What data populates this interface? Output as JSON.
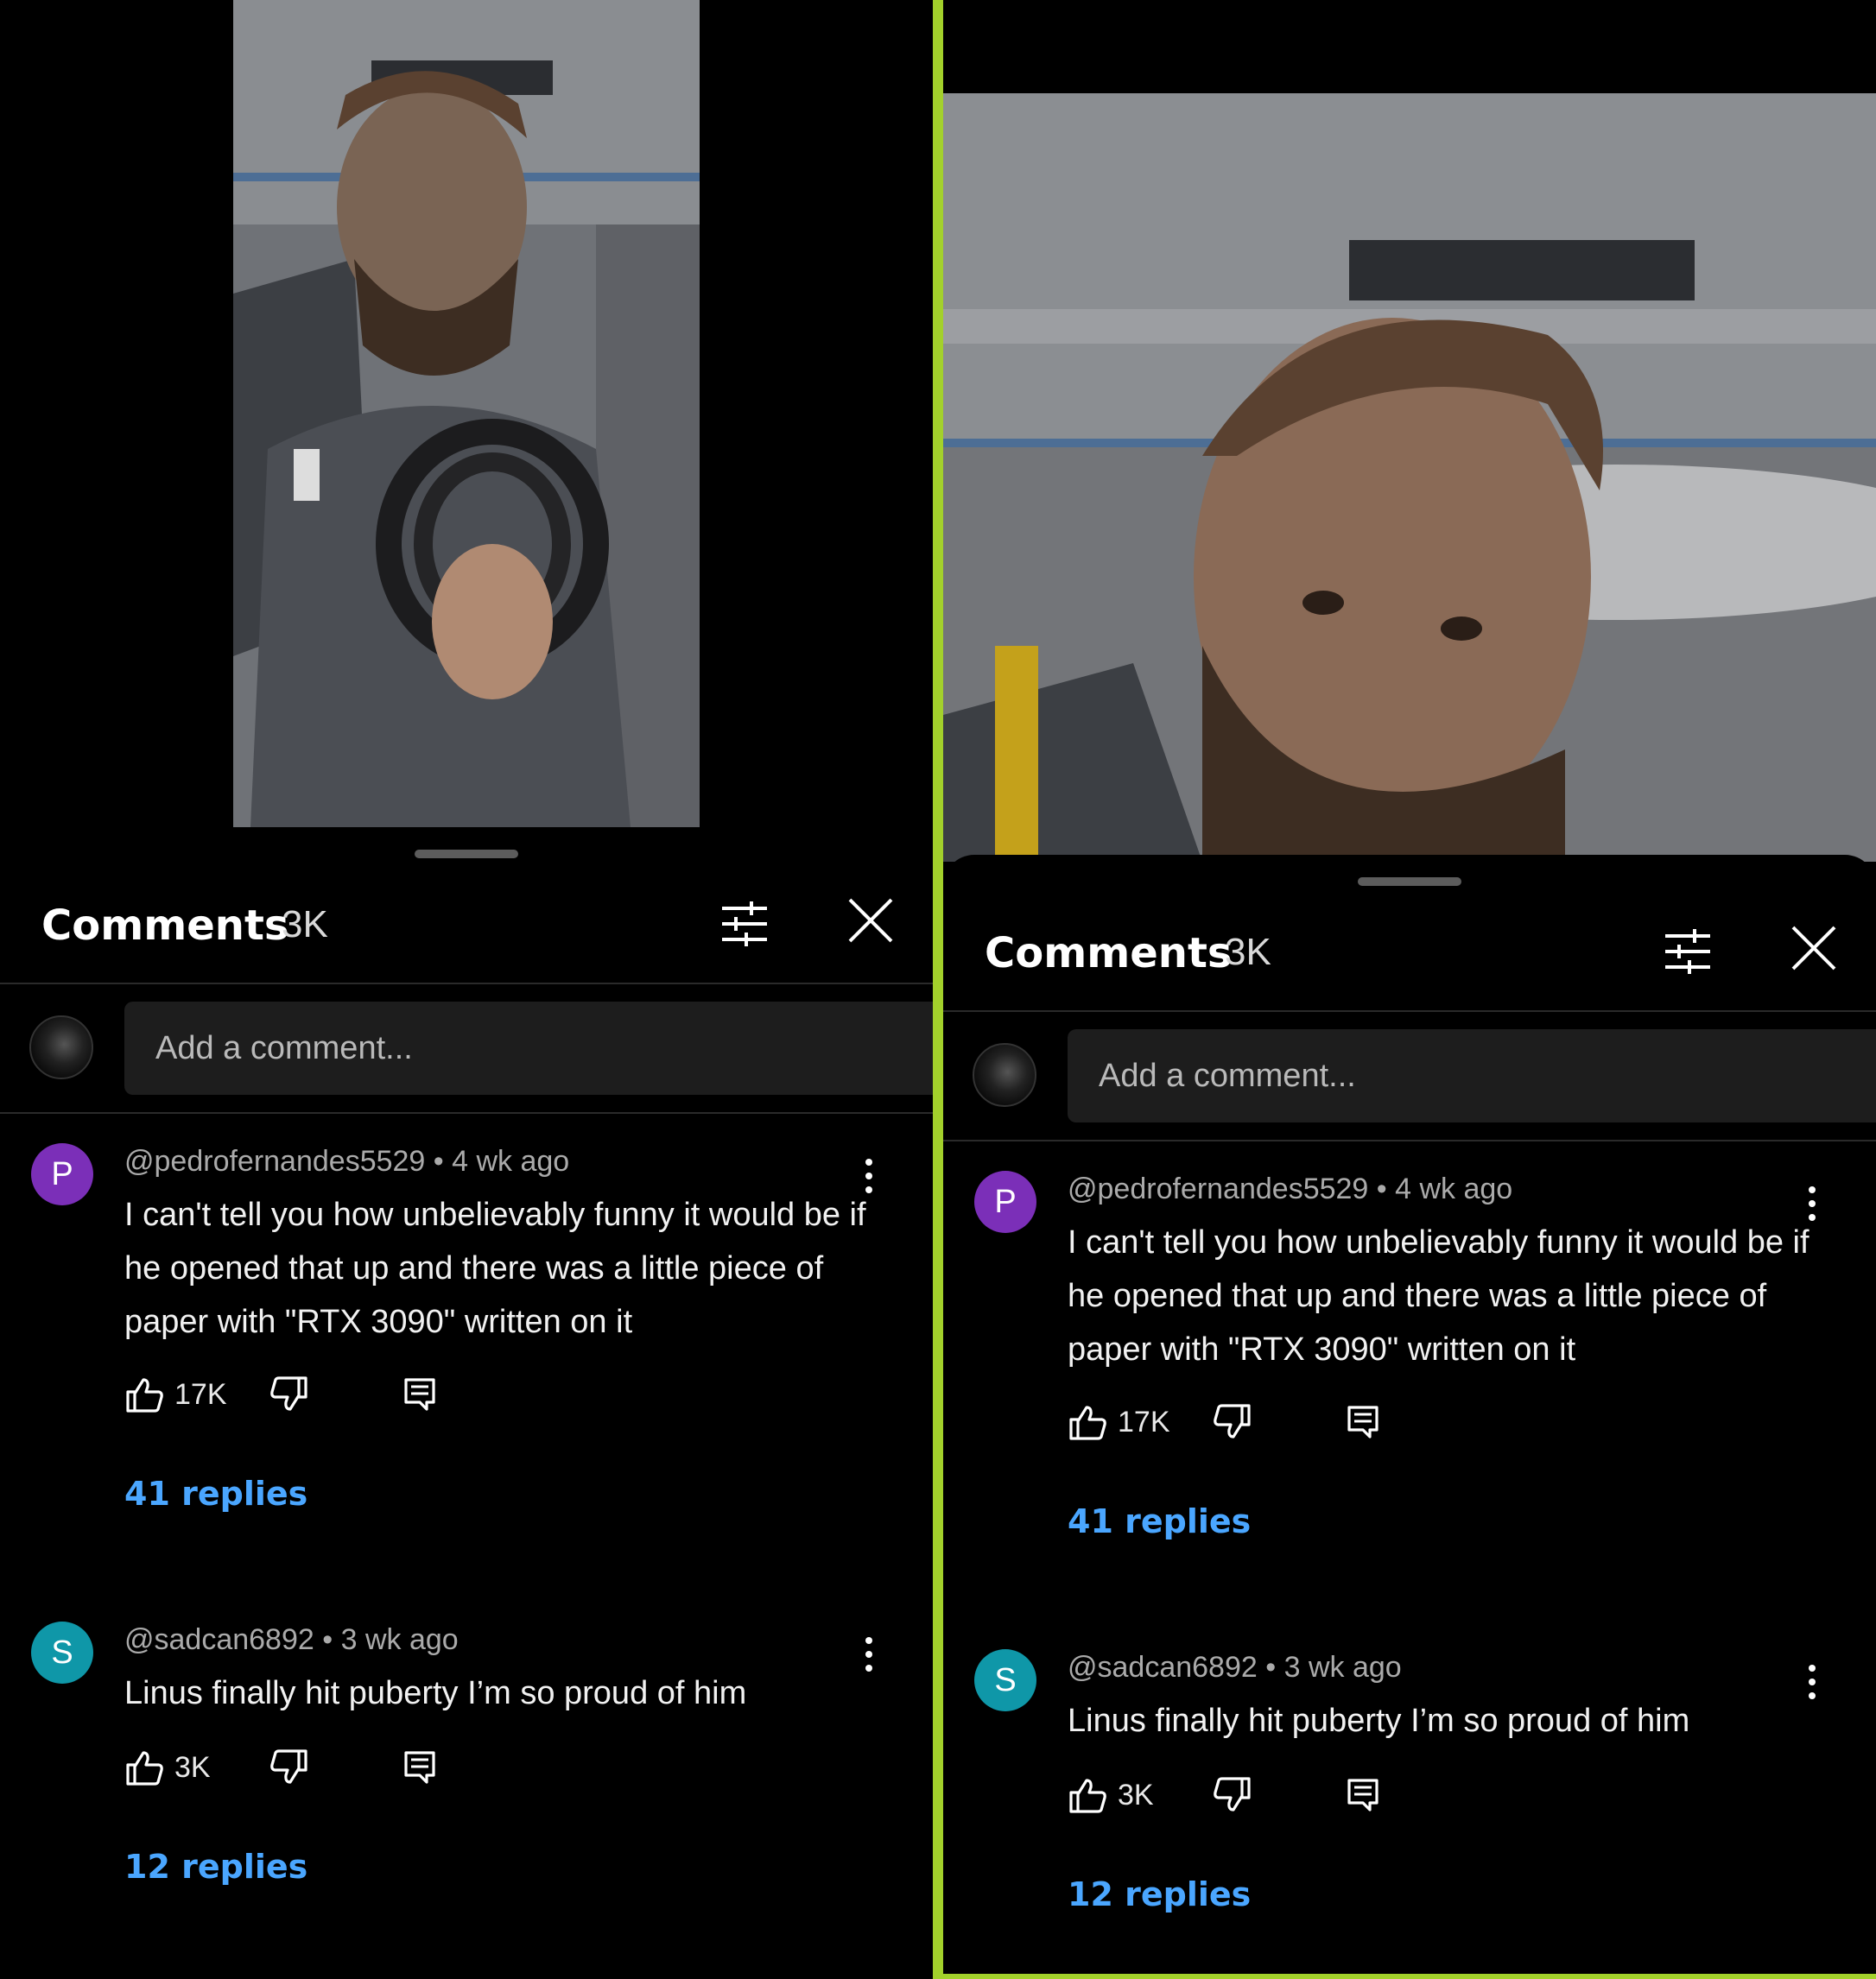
{
  "comments_panel": {
    "title": "Comments",
    "count": "3K",
    "filter_icon": "sliders-icon",
    "close_icon": "close-icon",
    "composer_placeholder": "Add a comment...",
    "accent_reply_color": "#4aa6ff",
    "divider_color": "#a3d12b"
  },
  "comments": [
    {
      "avatar_letter": "P",
      "avatar_color": "#7b2fb8",
      "author": "@pedrofernandes5529",
      "age": "4 wk ago",
      "meta": "@pedrofernandes5529 • 4 wk ago",
      "text": "I can't tell you how unbelievably funny it would be if he opened that up and there was a little piece of paper with \"RTX 3090\" written on it",
      "likes": "17K",
      "replies": "41 replies"
    },
    {
      "avatar_letter": "S",
      "avatar_color": "#0f97a8",
      "author": "@sadcan6892",
      "age": "3 wk ago",
      "meta": "@sadcan6892 • 3 wk ago",
      "text": "Linus finally hit puberty I’m so proud of him",
      "likes": "3K",
      "replies": "12 replies"
    }
  ]
}
